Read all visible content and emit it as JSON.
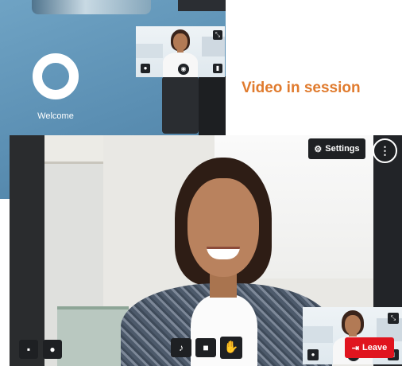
{
  "caption": "Video in session",
  "welcome_screen": {
    "welcome_text": "Welcome",
    "thumbnail_icons": {
      "expand": "expand-icon",
      "mic": "microphone-icon",
      "camera": "camera-icon",
      "signal": "signal-icon"
    }
  },
  "session_screen": {
    "settings_label": "Settings",
    "settings_icon": "gear-icon",
    "more_icon": "more-vertical-icon",
    "toolbar": {
      "chat_icon": "chat-icon",
      "participants_icon": "person-icon",
      "mic_icon": "microphone-icon",
      "camera_icon": "video-camera-icon",
      "hand_icon": "raise-hand-icon",
      "leave_label": "Leave",
      "leave_icon": "exit-icon"
    }
  },
  "colors": {
    "caption": "#e07b2e",
    "leave_button": "#e0141e",
    "control_bg": "#1e2023",
    "welcome_bg": "#5b8fb3"
  }
}
